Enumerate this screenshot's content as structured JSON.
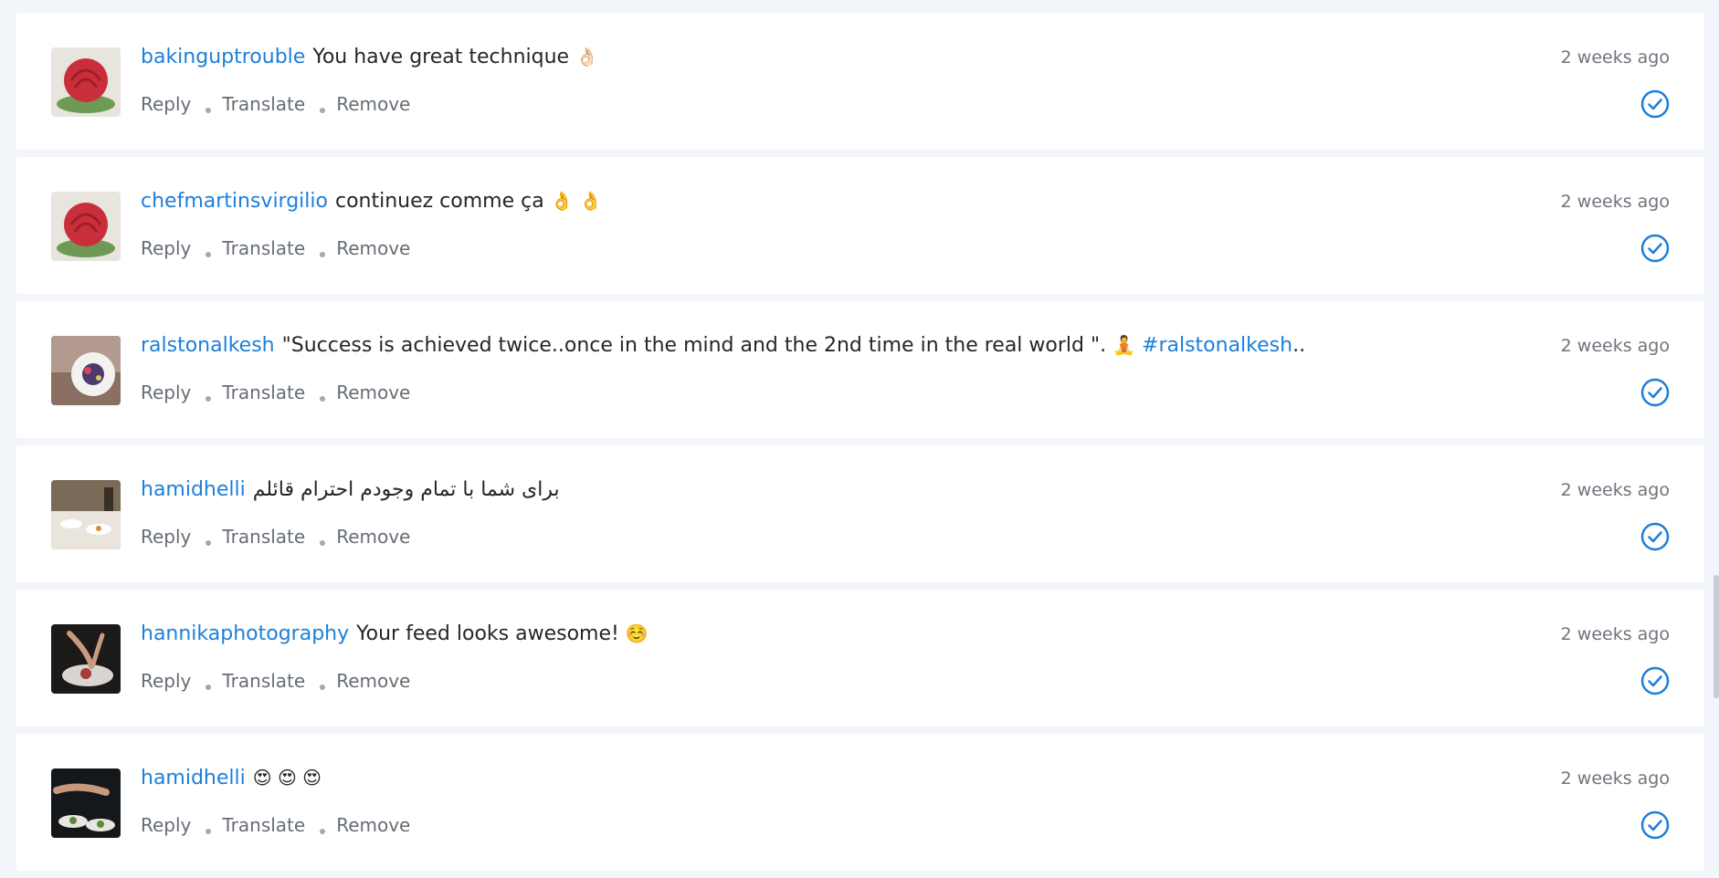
{
  "accent_color": "#1d7fd9",
  "comments": [
    {
      "username": "bakinguptrouble",
      "text": "You have great technique",
      "emoji": "👌🏻",
      "hashtag": "",
      "suffix": "",
      "timestamp": "2 weeks ago",
      "avatar_icon": "rose-cake-avatar",
      "actions": {
        "reply": "Reply",
        "translate": "Translate",
        "remove": "Remove"
      }
    },
    {
      "username": "chefmartinsvirgilio",
      "text": "continuez comme ça",
      "emoji": "👌 👌",
      "hashtag": "",
      "suffix": "",
      "timestamp": "2 weeks ago",
      "avatar_icon": "rose-cake-avatar",
      "actions": {
        "reply": "Reply",
        "translate": "Translate",
        "remove": "Remove"
      }
    },
    {
      "username": "ralstonalkesh",
      "text": "\"Success is achieved twice..once in the mind and the 2nd time in the real world \".",
      "emoji": "🧘",
      "hashtag": "#ralstonalkesh",
      "suffix": "..",
      "timestamp": "2 weeks ago",
      "avatar_icon": "plated-dish-avatar",
      "actions": {
        "reply": "Reply",
        "translate": "Translate",
        "remove": "Remove"
      }
    },
    {
      "username": "hamidhelli",
      "text": "برای شما با تمام وجودم احترام قائلم",
      "emoji": "",
      "hashtag": "",
      "suffix": "",
      "timestamp": "2 weeks ago",
      "avatar_icon": "restaurant-table-avatar",
      "actions": {
        "reply": "Reply",
        "translate": "Translate",
        "remove": "Remove"
      }
    },
    {
      "username": "hannikaphotography",
      "text": "Your feed looks awesome!",
      "emoji": "☺️",
      "hashtag": "",
      "suffix": "",
      "timestamp": "2 weeks ago",
      "avatar_icon": "chef-plating-avatar",
      "actions": {
        "reply": "Reply",
        "translate": "Translate",
        "remove": "Remove"
      }
    },
    {
      "username": "hamidhelli",
      "text": "",
      "emoji": "😍 😍 😍",
      "hashtag": "",
      "suffix": "",
      "timestamp": "2 weeks ago",
      "avatar_icon": "chef-hands-avatar",
      "actions": {
        "reply": "Reply",
        "translate": "Translate",
        "remove": "Remove"
      }
    }
  ]
}
